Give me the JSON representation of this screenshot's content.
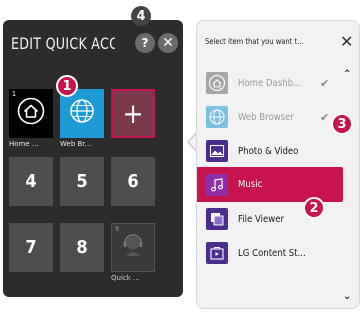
{
  "left_panel": {
    "title": "EDIT QUICK ACC...",
    "help_label": "?",
    "close_label": "✕",
    "tiles": [
      {
        "index": "1",
        "caption": "Home ..."
      },
      {
        "index": "2",
        "caption": "Web Br..."
      },
      {
        "add_label": "+"
      },
      {
        "number": "4"
      },
      {
        "number": "5"
      },
      {
        "number": "6"
      },
      {
        "number": "7"
      },
      {
        "number": "8"
      },
      {
        "index": "9",
        "caption": "Quick ..."
      }
    ]
  },
  "right_panel": {
    "header": "Select item that you want t...",
    "close_label": "✕",
    "items": [
      {
        "label": "Home Dashb...",
        "icon": "home-icon",
        "state": "added",
        "check": "✔"
      },
      {
        "label": "Web Browser",
        "icon": "globe-icon",
        "state": "added",
        "check": "✔"
      },
      {
        "label": "Photo & Video",
        "icon": "photo-video-icon",
        "state": "normal"
      },
      {
        "label": "Music",
        "icon": "music-note-icon",
        "state": "selected"
      },
      {
        "label": "File Viewer",
        "icon": "file-viewer-icon",
        "state": "normal"
      },
      {
        "label": "LG Content St...",
        "icon": "lg-content-store-icon",
        "state": "normal"
      }
    ]
  },
  "callouts": [
    "1",
    "2",
    "3",
    "4"
  ],
  "colors": {
    "accent": "#c8144e",
    "panel_dark": "#2c2c2c",
    "tile": "#4e4e4e",
    "web_blue": "#1e9ad6",
    "icon_purple": "#4b2d8c"
  }
}
